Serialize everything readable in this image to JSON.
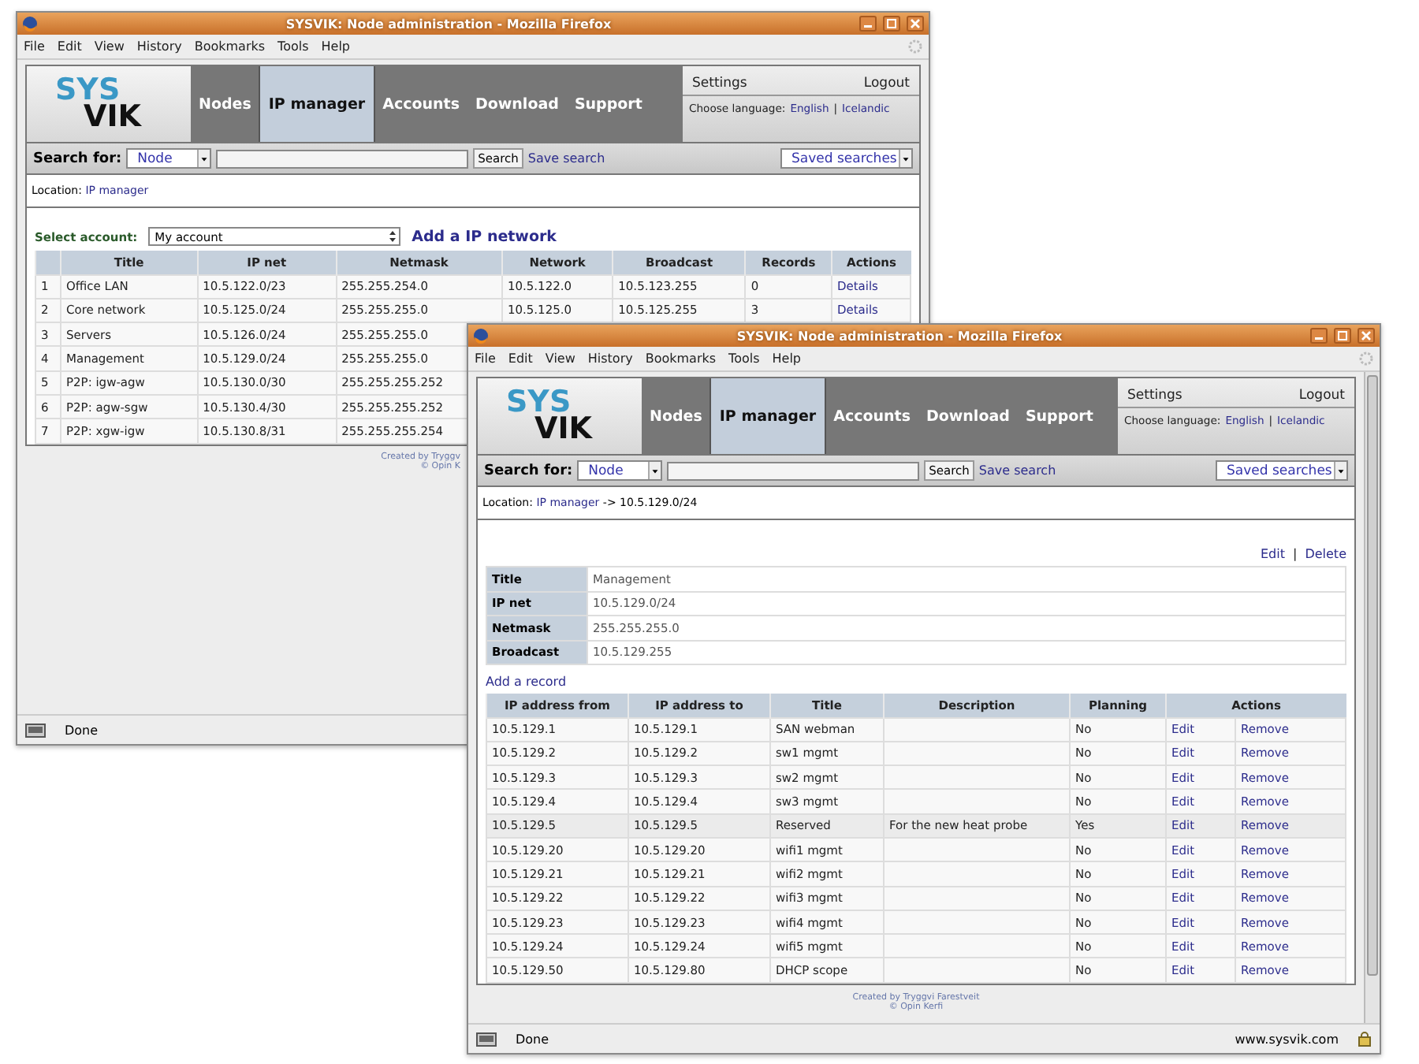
{
  "windows": [
    {
      "title": "SYSVIK: Node administration - Mozilla Firefox",
      "menu": [
        "File",
        "Edit",
        "View",
        "History",
        "Bookmarks",
        "Tools",
        "Help"
      ],
      "logo": [
        "SYS",
        "VIK"
      ],
      "nav": [
        {
          "label": "Nodes",
          "selected": false
        },
        {
          "label": "IP manager",
          "selected": true
        },
        {
          "label": "Accounts",
          "selected": false
        },
        {
          "label": "Download",
          "selected": false
        },
        {
          "label": "Support",
          "selected": false
        }
      ],
      "settings": "Settings",
      "logout": "Logout",
      "language_label": "Choose language:",
      "languages": [
        "English",
        "Icelandic"
      ],
      "separator": "|",
      "search": {
        "label": "Search for:",
        "type": "Node",
        "button": "Search",
        "save": "Save search",
        "saved": "Saved searches"
      },
      "location": {
        "label": "Location:",
        "link": "IP manager"
      },
      "account": {
        "label": "Select account:",
        "value": "My account",
        "add": "Add a IP network"
      },
      "networks": {
        "columns": [
          "Title",
          "IP net",
          "Netmask",
          "Network",
          "Broadcast",
          "Records",
          "Actions"
        ],
        "rows": [
          {
            "number": "1",
            "cells": [
              "Office LAN",
              "10.5.122.0/23",
              "255.255.254.0",
              "10.5.122.0",
              "10.5.123.255",
              "0"
            ],
            "action": "Details"
          },
          {
            "number": "2",
            "cells": [
              "Core network",
              "10.5.125.0/24",
              "255.255.255.0",
              "10.5.125.0",
              "10.5.125.255",
              "3"
            ],
            "action": "Details"
          },
          {
            "number": "3",
            "cells": [
              "Servers",
              "10.5.126.0/24",
              "255.255.255.0"
            ]
          },
          {
            "number": "4",
            "cells": [
              "Management",
              "10.5.129.0/24",
              "255.255.255.0"
            ]
          },
          {
            "number": "5",
            "cells": [
              "P2P: igw-agw",
              "10.5.130.0/30",
              "255.255.255.252"
            ]
          },
          {
            "number": "6",
            "cells": [
              "P2P: agw-sgw",
              "10.5.130.4/30",
              "255.255.255.252"
            ]
          },
          {
            "number": "7",
            "cells": [
              "P2P: xgw-igw",
              "10.5.130.8/31",
              "255.255.255.254"
            ]
          }
        ]
      },
      "footer": [
        "Created by Tryggv",
        "© Opin K"
      ],
      "status": {
        "text": "Done"
      },
      "scrollbar": false
    },
    {
      "title": "SYSVIK: Node administration - Mozilla Firefox",
      "menu": [
        "File",
        "Edit",
        "View",
        "History",
        "Bookmarks",
        "Tools",
        "Help"
      ],
      "logo": [
        "SYS",
        "VIK"
      ],
      "nav": [
        {
          "label": "Nodes",
          "selected": false
        },
        {
          "label": "IP manager",
          "selected": true
        },
        {
          "label": "Accounts",
          "selected": false
        },
        {
          "label": "Download",
          "selected": false
        },
        {
          "label": "Support",
          "selected": false
        }
      ],
      "settings": "Settings",
      "logout": "Logout",
      "language_label": "Choose language:",
      "languages": [
        "English",
        "Icelandic"
      ],
      "separator": "|",
      "search": {
        "label": "Search for:",
        "type": "Node",
        "button": "Search",
        "save": "Save search",
        "saved": "Saved searches"
      },
      "location": {
        "label": "Location:",
        "link": "IP manager",
        "rest": "-> 10.5.129.0/24"
      },
      "actions": [
        "Edit",
        "Delete"
      ],
      "details": [
        {
          "label": "Title",
          "value": "Management"
        },
        {
          "label": "IP net",
          "value": "10.5.129.0/24"
        },
        {
          "label": "Netmask",
          "value": "255.255.255.0"
        },
        {
          "label": "Broadcast",
          "value": "10.5.129.255"
        }
      ],
      "add_record": "Add a record",
      "records": {
        "columns": [
          "IP address from",
          "IP address to",
          "Title",
          "Description",
          "Planning",
          "Actions"
        ],
        "rows": [
          {
            "from": "10.5.129.1",
            "to": "10.5.129.1",
            "title": "SAN webman",
            "planning": "No",
            "edit": "Edit",
            "remove": "Remove",
            "selected": false
          },
          {
            "from": "10.5.129.2",
            "to": "10.5.129.2",
            "title": "sw1 mgmt",
            "planning": "No",
            "edit": "Edit",
            "remove": "Remove",
            "selected": false
          },
          {
            "from": "10.5.129.3",
            "to": "10.5.129.3",
            "title": "sw2 mgmt",
            "planning": "No",
            "edit": "Edit",
            "remove": "Remove",
            "selected": false
          },
          {
            "from": "10.5.129.4",
            "to": "10.5.129.4",
            "title": "sw3 mgmt",
            "planning": "No",
            "edit": "Edit",
            "remove": "Remove",
            "selected": false
          },
          {
            "from": "10.5.129.5",
            "to": "10.5.129.5",
            "title": "Reserved",
            "description": "For the new heat probe",
            "planning": "Yes",
            "edit": "Edit",
            "remove": "Remove",
            "selected": true
          },
          {
            "from": "10.5.129.20",
            "to": "10.5.129.20",
            "title": "wifi1 mgmt",
            "planning": "No",
            "edit": "Edit",
            "remove": "Remove",
            "selected": false
          },
          {
            "from": "10.5.129.21",
            "to": "10.5.129.21",
            "title": "wifi2 mgmt",
            "planning": "No",
            "edit": "Edit",
            "remove": "Remove",
            "selected": false
          },
          {
            "from": "10.5.129.22",
            "to": "10.5.129.22",
            "title": "wifi3 mgmt",
            "planning": "No",
            "edit": "Edit",
            "remove": "Remove",
            "selected": false
          },
          {
            "from": "10.5.129.23",
            "to": "10.5.129.23",
            "title": "wifi4 mgmt",
            "planning": "No",
            "edit": "Edit",
            "remove": "Remove",
            "selected": false
          },
          {
            "from": "10.5.129.24",
            "to": "10.5.129.24",
            "title": "wifi5 mgmt",
            "planning": "No",
            "edit": "Edit",
            "remove": "Remove",
            "selected": false
          },
          {
            "from": "10.5.129.50",
            "to": "10.5.129.80",
            "title": "DHCP scope",
            "planning": "No",
            "edit": "Edit",
            "remove": "Remove",
            "selected": false
          }
        ]
      },
      "footer": [
        "Created by Tryggvi Farestveit",
        "© Opin Kerfi"
      ],
      "status": {
        "text": "Done",
        "url": "www.sysvik.com"
      },
      "scrollbar": true
    }
  ]
}
